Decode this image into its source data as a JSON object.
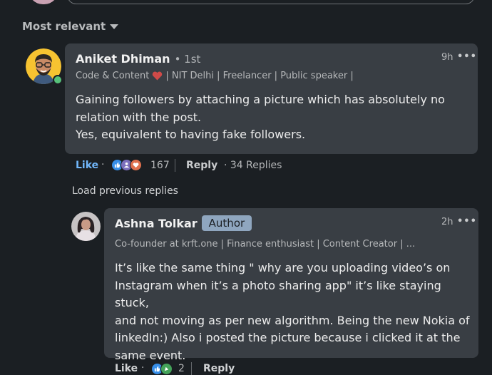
{
  "sort": {
    "label": "Most relevant"
  },
  "comment": {
    "author": "Aniket Dhiman",
    "degree": "• 1st",
    "headline_start": "Code & Content",
    "headline_end": "| NIT Delhi | Freelancer | Public speaker |",
    "time": "9h",
    "more": "•••",
    "text_lines": [
      "Gaining followers by attaching a picture which has absolutely no",
      "relation with the post.",
      "Yes, equivalent to having fake followers."
    ],
    "actions": {
      "like": "Like",
      "dot": "·",
      "reactions_count": "167",
      "reply": "Reply",
      "replies": "· 34 Replies"
    }
  },
  "load_previous": "Load previous replies",
  "reply": {
    "author": "Ashna Tolkar",
    "badge": "Author",
    "headline": "Co-founder at krft.one | Finance enthusiast | Content Creator | ...",
    "time": "2h",
    "more": "•••",
    "text_lines": [
      "It’s like the same thing \" why are you uploading video’s on",
      "Instagram when it’s a photo sharing app\" it’s like staying stuck,",
      "and not moving as per new algorithm. Being the new Nokia of",
      "linkedIn:) Also i posted the picture because i clicked it at the",
      "same event."
    ],
    "actions": {
      "like": "Like",
      "dot": "·",
      "reactions_count": "2",
      "reply": "Reply"
    }
  },
  "colors": {
    "background": "#1b1f23",
    "bubble": "#393e44",
    "link": "#71b7fb",
    "author_badge": "#8fa6bf",
    "online": "#57c27a"
  }
}
